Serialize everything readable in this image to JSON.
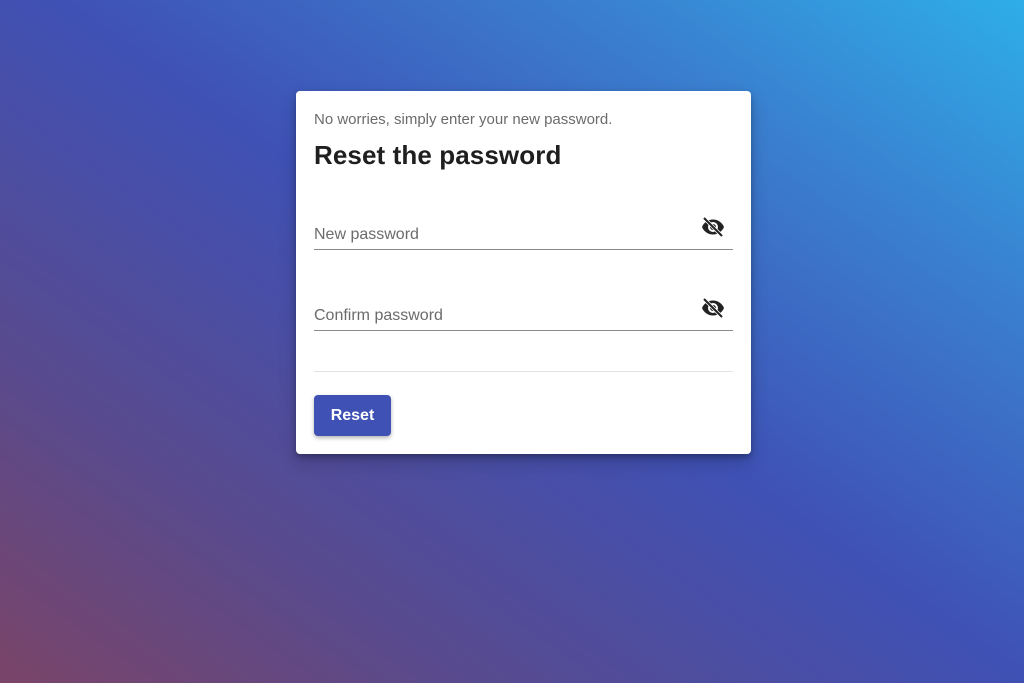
{
  "form": {
    "subtitle": "No worries, simply enter your new password.",
    "title": "Reset the password",
    "new_password": {
      "value": "",
      "placeholder": "New password",
      "icon": "eye-off-icon"
    },
    "confirm_password": {
      "value": "",
      "placeholder": "Confirm password",
      "icon": "eye-off-icon"
    },
    "submit_label": "Reset"
  },
  "colors": {
    "accent": "#3f51b5",
    "gradient_start": "#7a4468",
    "gradient_end": "#2eaee8"
  }
}
